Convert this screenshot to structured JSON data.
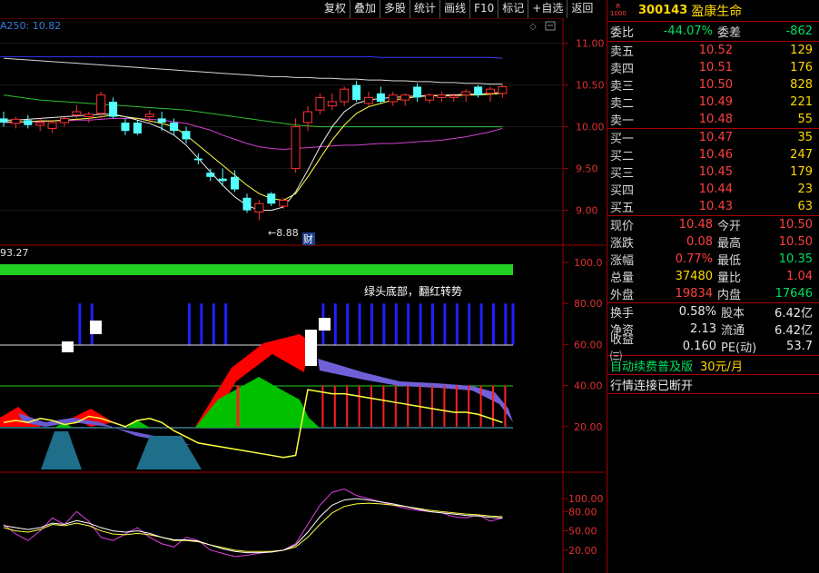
{
  "toolbar": [
    "复权",
    "叠加",
    "多股",
    "统计",
    "画线",
    "F10",
    "标记",
    "+自选",
    "返回"
  ],
  "stock": {
    "badge_top": "R",
    "badge_bottom": "1000",
    "code": "300143",
    "name": "盈康生命"
  },
  "summary": {
    "ratio_label": "委比",
    "ratio": "-44.07%",
    "diff_label": "委差",
    "diff": "-862"
  },
  "asks": [
    {
      "label": "卖五",
      "price": "10.52",
      "vol": "129"
    },
    {
      "label": "卖四",
      "price": "10.51",
      "vol": "176"
    },
    {
      "label": "卖三",
      "price": "10.50",
      "vol": "828"
    },
    {
      "label": "卖二",
      "price": "10.49",
      "vol": "221"
    },
    {
      "label": "卖一",
      "price": "10.48",
      "vol": "55"
    }
  ],
  "bids": [
    {
      "label": "买一",
      "price": "10.47",
      "vol": "35"
    },
    {
      "label": "买二",
      "price": "10.46",
      "vol": "247"
    },
    {
      "label": "买三",
      "price": "10.45",
      "vol": "179"
    },
    {
      "label": "买四",
      "price": "10.44",
      "vol": "23"
    },
    {
      "label": "买五",
      "price": "10.43",
      "vol": "63"
    }
  ],
  "stats": [
    {
      "l1": "现价",
      "v1": "10.48",
      "c1": "red",
      "l2": "今开",
      "v2": "10.50",
      "c2": "red"
    },
    {
      "l1": "涨跌",
      "v1": "0.08",
      "c1": "red",
      "l2": "最高",
      "v2": "10.50",
      "c2": "red"
    },
    {
      "l1": "涨幅",
      "v1": "0.77%",
      "c1": "red",
      "l2": "最低",
      "v2": "10.35",
      "c2": "green"
    },
    {
      "l1": "总量",
      "v1": "37480",
      "c1": "yellow",
      "l2": "量比",
      "v2": "1.04",
      "c2": "red"
    },
    {
      "l1": "外盘",
      "v1": "19834",
      "c1": "red",
      "l2": "内盘",
      "v2": "17646",
      "c2": "green"
    }
  ],
  "details": [
    {
      "l1": "换手",
      "v1": "0.58%",
      "l2": "股本",
      "v2": "6.42亿"
    },
    {
      "l1": "净资",
      "v1": "2.13",
      "l2": "流通",
      "v2": "6.42亿"
    },
    {
      "l1": "收益㈢",
      "v1": "0.160",
      "l2": "PE(动)",
      "v2": "53.7"
    }
  ],
  "plan": {
    "text": "自动续费普及版",
    "price": "30元/月"
  },
  "status": "行情连接已断开",
  "price_chart": {
    "indicator_label": "A250: 10.82",
    "y_ticks": [
      "11.00",
      "10.50",
      "10.00",
      "9.50",
      "9.00"
    ],
    "low_marker": "←8.88",
    "fin_marker": "财"
  },
  "mid_chart": {
    "value_label": "93.27",
    "annotation": "绿头底部，翻红转势",
    "y_ticks": [
      "100.0",
      "80.00",
      "60.00",
      "40.00",
      "20.00"
    ]
  },
  "low_chart": {
    "y_ticks": [
      "100.00",
      "80.00",
      "50.00",
      "20.00"
    ]
  },
  "chart_data": {
    "type": "candlestick",
    "ylim": [
      8.8,
      11.3
    ],
    "candles": [
      {
        "o": 10.1,
        "h": 10.18,
        "l": 10.0,
        "c": 10.05,
        "up": false
      },
      {
        "o": 10.04,
        "h": 10.12,
        "l": 9.98,
        "c": 10.09,
        "up": true
      },
      {
        "o": 10.08,
        "h": 10.14,
        "l": 9.98,
        "c": 10.02,
        "up": false
      },
      {
        "o": 10.02,
        "h": 10.1,
        "l": 9.95,
        "c": 10.05,
        "up": true
      },
      {
        "o": 9.98,
        "h": 10.06,
        "l": 9.93,
        "c": 10.05,
        "up": true
      },
      {
        "o": 10.05,
        "h": 10.12,
        "l": 10.0,
        "c": 10.1,
        "up": true
      },
      {
        "o": 10.18,
        "h": 10.26,
        "l": 10.1,
        "c": 10.14,
        "up": true
      },
      {
        "o": 10.12,
        "h": 10.18,
        "l": 10.05,
        "c": 10.15,
        "up": true
      },
      {
        "o": 10.16,
        "h": 10.42,
        "l": 10.1,
        "c": 10.38,
        "up": true
      },
      {
        "o": 10.3,
        "h": 10.35,
        "l": 10.1,
        "c": 10.12,
        "up": false
      },
      {
        "o": 10.05,
        "h": 10.1,
        "l": 9.9,
        "c": 9.95,
        "up": false
      },
      {
        "o": 10.05,
        "h": 10.08,
        "l": 9.9,
        "c": 9.92,
        "up": false
      },
      {
        "o": 10.12,
        "h": 10.2,
        "l": 10.05,
        "c": 10.15,
        "up": true
      },
      {
        "o": 10.1,
        "h": 10.18,
        "l": 9.95,
        "c": 10.05,
        "up": false
      },
      {
        "o": 10.05,
        "h": 10.1,
        "l": 9.9,
        "c": 9.95,
        "up": false
      },
      {
        "o": 9.95,
        "h": 10.0,
        "l": 9.8,
        "c": 9.85,
        "up": false
      },
      {
        "o": 9.6,
        "h": 9.68,
        "l": 9.55,
        "c": 9.62,
        "up": false
      },
      {
        "o": 9.45,
        "h": 9.5,
        "l": 9.35,
        "c": 9.4,
        "up": false
      },
      {
        "o": 9.35,
        "h": 9.5,
        "l": 9.3,
        "c": 9.38,
        "up": false
      },
      {
        "o": 9.4,
        "h": 9.48,
        "l": 9.22,
        "c": 9.25,
        "up": false
      },
      {
        "o": 9.15,
        "h": 9.2,
        "l": 8.97,
        "c": 9.0,
        "up": false
      },
      {
        "o": 8.98,
        "h": 9.12,
        "l": 8.88,
        "c": 9.08,
        "up": true
      },
      {
        "o": 9.2,
        "h": 9.22,
        "l": 9.05,
        "c": 9.08,
        "up": false
      },
      {
        "o": 9.05,
        "h": 9.15,
        "l": 9.02,
        "c": 9.12,
        "up": true
      },
      {
        "o": 9.5,
        "h": 10.1,
        "l": 9.45,
        "c": 10.0,
        "up": true
      },
      {
        "o": 10.05,
        "h": 10.25,
        "l": 9.95,
        "c": 10.18,
        "up": true
      },
      {
        "o": 10.2,
        "h": 10.4,
        "l": 10.15,
        "c": 10.35,
        "up": true
      },
      {
        "o": 10.25,
        "h": 10.4,
        "l": 10.2,
        "c": 10.3,
        "up": true
      },
      {
        "o": 10.3,
        "h": 10.48,
        "l": 10.25,
        "c": 10.45,
        "up": true
      },
      {
        "o": 10.5,
        "h": 10.55,
        "l": 10.3,
        "c": 10.32,
        "up": false
      },
      {
        "o": 10.28,
        "h": 10.42,
        "l": 10.25,
        "c": 10.35,
        "up": true
      },
      {
        "o": 10.4,
        "h": 10.48,
        "l": 10.28,
        "c": 10.3,
        "up": false
      },
      {
        "o": 10.3,
        "h": 10.42,
        "l": 10.25,
        "c": 10.38,
        "up": true
      },
      {
        "o": 10.32,
        "h": 10.4,
        "l": 10.25,
        "c": 10.38,
        "up": true
      },
      {
        "o": 10.48,
        "h": 10.52,
        "l": 10.3,
        "c": 10.35,
        "up": false
      },
      {
        "o": 10.32,
        "h": 10.4,
        "l": 10.28,
        "c": 10.38,
        "up": true
      },
      {
        "o": 10.35,
        "h": 10.42,
        "l": 10.3,
        "c": 10.38,
        "up": true
      },
      {
        "o": 10.35,
        "h": 10.4,
        "l": 10.3,
        "c": 10.37,
        "up": true
      },
      {
        "o": 10.38,
        "h": 10.45,
        "l": 10.3,
        "c": 10.42,
        "up": true
      },
      {
        "o": 10.48,
        "h": 10.5,
        "l": 10.35,
        "c": 10.38,
        "up": false
      },
      {
        "o": 10.4,
        "h": 10.48,
        "l": 10.3,
        "c": 10.45,
        "up": true
      },
      {
        "o": 10.4,
        "h": 10.5,
        "l": 10.35,
        "c": 10.48,
        "up": true
      }
    ],
    "ma_blue": [
      10.84,
      10.84,
      10.84,
      10.84,
      10.84,
      10.84,
      10.84,
      10.84,
      10.84,
      10.84,
      10.84,
      10.84,
      10.84,
      10.84,
      10.84,
      10.84,
      10.84,
      10.84,
      10.84,
      10.84,
      10.84,
      10.84,
      10.84,
      10.84,
      10.84,
      10.84,
      10.84,
      10.84,
      10.84,
      10.84,
      10.84,
      10.83,
      10.83,
      10.83,
      10.83,
      10.83,
      10.83,
      10.83,
      10.83,
      10.83,
      10.83,
      10.82
    ],
    "ma_white": [
      10.82,
      10.81,
      10.8,
      10.79,
      10.78,
      10.77,
      10.76,
      10.75,
      10.74,
      10.73,
      10.72,
      10.71,
      10.7,
      10.69,
      10.68,
      10.67,
      10.66,
      10.65,
      10.64,
      10.63,
      10.62,
      10.61,
      10.6,
      10.6,
      10.59,
      10.59,
      10.58,
      10.58,
      10.57,
      10.57,
      10.56,
      10.56,
      10.55,
      10.55,
      10.54,
      10.54,
      10.53,
      10.53,
      10.52,
      10.52,
      10.51,
      10.51
    ],
    "ma_green": [
      10.38,
      10.36,
      10.34,
      10.32,
      10.31,
      10.3,
      10.29,
      10.28,
      10.27,
      10.26,
      10.25,
      10.24,
      10.23,
      10.22,
      10.21,
      10.2,
      10.18,
      10.16,
      10.14,
      10.12,
      10.1,
      10.08,
      10.06,
      10.04,
      10.02,
      10.01,
      10.0,
      10.0,
      10.0,
      10.0,
      10.0,
      10.0,
      10.0,
      10.0,
      10.0,
      10.0,
      10.0,
      10.0,
      10.0,
      10.0,
      10.0,
      10.0
    ],
    "ma_magenta": [
      10.05,
      10.05,
      10.06,
      10.06,
      10.07,
      10.07,
      10.08,
      10.08,
      10.09,
      10.1,
      10.1,
      10.1,
      10.09,
      10.08,
      10.06,
      10.04,
      10.0,
      9.96,
      9.9,
      9.85,
      9.8,
      9.76,
      9.74,
      9.73,
      9.74,
      9.75,
      9.76,
      9.77,
      9.78,
      9.78,
      9.79,
      9.8,
      9.8,
      9.81,
      9.82,
      9.83,
      9.84,
      9.86,
      9.88,
      9.91,
      9.94,
      9.98
    ],
    "ma_yellow": [
      10.06,
      10.06,
      10.06,
      10.07,
      10.07,
      10.08,
      10.09,
      10.1,
      10.12,
      10.14,
      10.12,
      10.1,
      10.07,
      10.04,
      10.0,
      9.9,
      9.78,
      9.66,
      9.54,
      9.42,
      9.3,
      9.2,
      9.14,
      9.12,
      9.2,
      9.4,
      9.62,
      9.84,
      10.02,
      10.16,
      10.24,
      10.28,
      10.32,
      10.34,
      10.36,
      10.37,
      10.37,
      10.37,
      10.38,
      10.38,
      10.39,
      10.4
    ],
    "ma_white2": [
      10.08,
      10.08,
      10.09,
      10.1,
      10.11,
      10.12,
      10.13,
      10.14,
      10.15,
      10.15,
      10.12,
      10.08,
      10.04,
      9.98,
      9.9,
      9.78,
      9.62,
      9.46,
      9.3,
      9.16,
      9.06,
      9.0,
      9.0,
      9.04,
      9.22,
      9.48,
      9.76,
      10.0,
      10.18,
      10.28,
      10.32,
      10.34,
      10.35,
      10.36,
      10.37,
      10.37,
      10.38,
      10.38,
      10.39,
      10.39,
      10.4,
      10.41
    ],
    "mid_bars": [
      {
        "i": 6,
        "color": "blue"
      },
      {
        "i": 7,
        "color": "blue"
      },
      {
        "i": 15,
        "color": "blue"
      },
      {
        "i": 16,
        "color": "blue"
      },
      {
        "i": 17,
        "color": "blue"
      },
      {
        "i": 18,
        "color": "blue"
      },
      {
        "i": 19,
        "color": "red"
      },
      {
        "i": 26,
        "color": "blue"
      },
      {
        "i": 27,
        "color": "blue"
      },
      {
        "i": 28,
        "color": "blue"
      },
      {
        "i": 29,
        "color": "blue"
      },
      {
        "i": 30,
        "color": "blue"
      },
      {
        "i": 31,
        "color": "blue"
      },
      {
        "i": 32,
        "color": "blue"
      },
      {
        "i": 33,
        "color": "blue"
      },
      {
        "i": 34,
        "color": "blue"
      },
      {
        "i": 35,
        "color": "blue"
      },
      {
        "i": 36,
        "color": "blue"
      },
      {
        "i": 37,
        "color": "blue"
      },
      {
        "i": 38,
        "color": "blue"
      },
      {
        "i": 39,
        "color": "blue"
      },
      {
        "i": 40,
        "color": "blue"
      },
      {
        "i": 41,
        "color": "blue"
      }
    ],
    "mid_yellow": [
      22,
      23,
      22,
      24,
      23,
      21,
      22,
      25,
      24,
      22,
      20,
      23,
      24,
      22,
      18,
      15,
      12,
      11,
      10,
      9,
      8,
      7,
      6,
      5,
      6,
      38,
      37,
      36,
      36,
      35,
      34,
      33,
      32,
      31,
      30,
      29,
      28,
      27,
      27,
      26,
      24,
      22
    ],
    "osc_magenta": [
      60,
      45,
      35,
      50,
      70,
      60,
      80,
      65,
      40,
      35,
      45,
      55,
      40,
      30,
      25,
      40,
      35,
      20,
      15,
      10,
      12,
      15,
      18,
      20,
      30,
      60,
      90,
      110,
      115,
      105,
      100,
      95,
      90,
      85,
      82,
      80,
      78,
      72,
      70,
      75,
      65,
      70
    ],
    "osc_yellow": [
      55,
      50,
      48,
      52,
      60,
      58,
      62,
      58,
      50,
      45,
      44,
      46,
      44,
      40,
      35,
      35,
      33,
      28,
      24,
      20,
      18,
      18,
      18,
      20,
      25,
      40,
      60,
      78,
      88,
      92,
      93,
      92,
      90,
      88,
      85,
      82,
      80,
      78,
      76,
      75,
      73,
      72
    ],
    "osc_white": [
      58,
      55,
      52,
      55,
      62,
      60,
      66,
      62,
      55,
      50,
      48,
      50,
      46,
      40,
      36,
      36,
      34,
      28,
      22,
      18,
      16,
      16,
      17,
      20,
      28,
      48,
      72,
      90,
      98,
      100,
      98,
      95,
      92,
      88,
      84,
      80,
      78,
      76,
      74,
      73,
      71,
      70
    ]
  }
}
